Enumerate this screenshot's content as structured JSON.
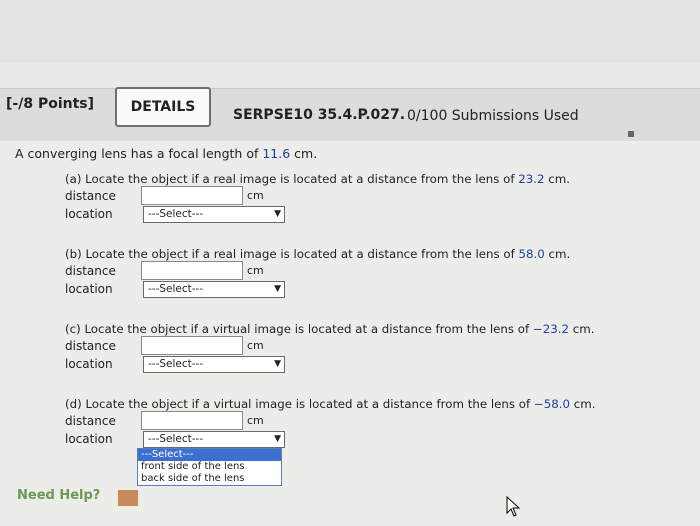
{
  "header": {
    "points": "[-/8 Points]",
    "details_label": "DETAILS",
    "problem_code": "SERPSE10 35.4.P.027.",
    "submissions": "0/100 Submissions Used"
  },
  "problem": {
    "intro_prefix": "A converging lens has a focal length of ",
    "focal_length": "11.6",
    "intro_suffix": " cm.",
    "parts": [
      {
        "prefix": "(a) Locate the object if a real image is located at a distance from the lens of ",
        "value": "23.2",
        "suffix": " cm.",
        "distance_label": "distance",
        "distance_value": "",
        "unit": "cm",
        "location_label": "location",
        "location_selected": "---Select---"
      },
      {
        "prefix": "(b) Locate the object if a real image is located at a distance from the lens of ",
        "value": "58.0",
        "suffix": " cm.",
        "distance_label": "distance",
        "distance_value": "",
        "unit": "cm",
        "location_label": "location",
        "location_selected": "---Select---"
      },
      {
        "prefix": "(c) Locate the object if a virtual image is located at a distance from the lens of ",
        "value": "−23.2",
        "suffix": " cm.",
        "distance_label": "distance",
        "distance_value": "",
        "unit": "cm",
        "location_label": "location",
        "location_selected": "---Select---"
      },
      {
        "prefix": "(d) Locate the object if a virtual image is located at a distance from the lens of ",
        "value": "−58.0",
        "suffix": " cm.",
        "distance_label": "distance",
        "distance_value": "",
        "unit": "cm",
        "location_label": "location",
        "location_selected": "---Select---"
      }
    ]
  },
  "dropdown": {
    "options": [
      "---Select---",
      "front side of the lens",
      "back side of the lens"
    ],
    "highlighted": "---Select---"
  },
  "footer": {
    "need_help": "Need Help?"
  },
  "icons": {
    "select_arrow": "chevron-down-icon",
    "cursor": "mouse-pointer-icon"
  }
}
